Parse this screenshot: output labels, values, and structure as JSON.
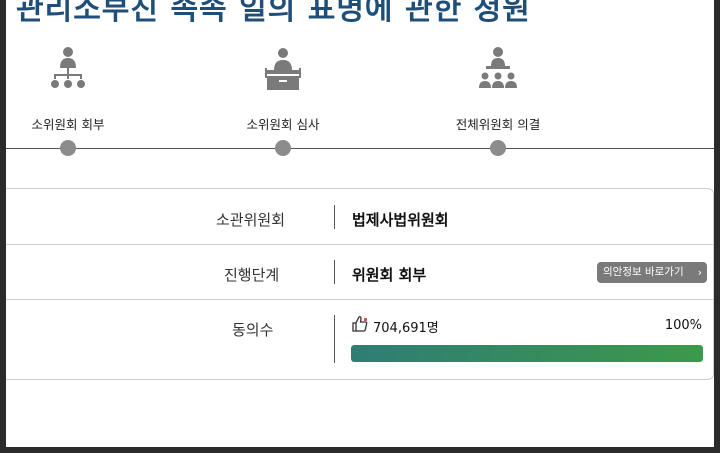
{
  "header": {
    "title": "관리소부진 속속 일의 표명에 관한 청원"
  },
  "steps": [
    {
      "label": "소위원회 회부",
      "icon": "organization-chart-icon"
    },
    {
      "label": "소위원회 심사",
      "icon": "podium-icon"
    },
    {
      "label": "전체위원회 의결",
      "icon": "assembly-icon"
    }
  ],
  "info": {
    "committee": {
      "label": "소관위원회",
      "value": "법제사법위원회"
    },
    "stage": {
      "label": "진행단계",
      "value": "위원회 회부",
      "button_label": "의안정보 바로가기"
    },
    "agree": {
      "label": "동의수",
      "count": "704,691명",
      "percent_label": "100%",
      "progress": 1.0
    }
  },
  "colors": {
    "title": "#1f4e79",
    "progress_start": "#2e7d75",
    "progress_end": "#3a9a4a",
    "button_bg": "#7a7a7a",
    "dot": "#8c8c8c"
  }
}
